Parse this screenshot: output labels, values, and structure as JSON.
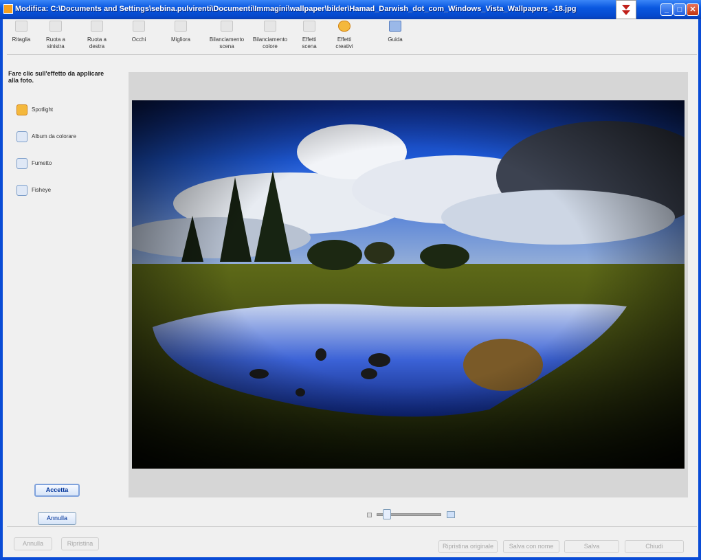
{
  "window": {
    "title": "Modifica: C:\\Documents and Settings\\sebina.pulvirenti\\Documenti\\Immagini\\wallpaper\\bilder\\Hamad_Darwish_dot_com_Windows_Vista_Wallpapers_-18.jpg",
    "minimize": "_",
    "maximize": "□",
    "close": "✕"
  },
  "toolbar": {
    "items": [
      {
        "label": "Ritaglia",
        "icon": "crop-icon"
      },
      {
        "label": "Ruota a sinistra",
        "icon": "rotate-left-icon"
      },
      {
        "label": "Ruota a destra",
        "icon": "rotate-right-icon"
      },
      {
        "label": "Occhi",
        "icon": "eye-icon"
      },
      {
        "label": "Migliora",
        "icon": "enhance-icon"
      },
      {
        "label": "Bilanciamento scena",
        "icon": "scene-balance-icon"
      },
      {
        "label": "Bilanciamento colore",
        "icon": "color-balance-icon"
      },
      {
        "label": "Effetti scena",
        "icon": "scene-effects-icon"
      },
      {
        "label": "Effetti creativi",
        "icon": "creative-effects-icon"
      },
      {
        "label": "Guida",
        "icon": "help-icon"
      }
    ]
  },
  "panel": {
    "instruction": "Fare clic sull'effetto da applicare alla foto.",
    "effects": [
      {
        "label": "Spotlight",
        "icon": "spotlight-icon"
      },
      {
        "label": "Album da colorare",
        "icon": "coloring-album-icon"
      },
      {
        "label": "Fumetto",
        "icon": "comic-icon"
      },
      {
        "label": "Fisheye",
        "icon": "fisheye-icon"
      }
    ],
    "accept_label": "Accetta",
    "cancel_label": "Annulla"
  },
  "zoom": {
    "level": 0.1
  },
  "footer": {
    "undo_label": "Annulla",
    "redo_label": "Ripristina",
    "restore_original_label": "Ripristina originale",
    "save_as_label": "Salva con nome",
    "save_label": "Salva",
    "close_label": "Chiudi"
  },
  "colors": {
    "titlebar": "#0a58e0",
    "accent": "#f4b83c",
    "button_text": "#003399"
  }
}
